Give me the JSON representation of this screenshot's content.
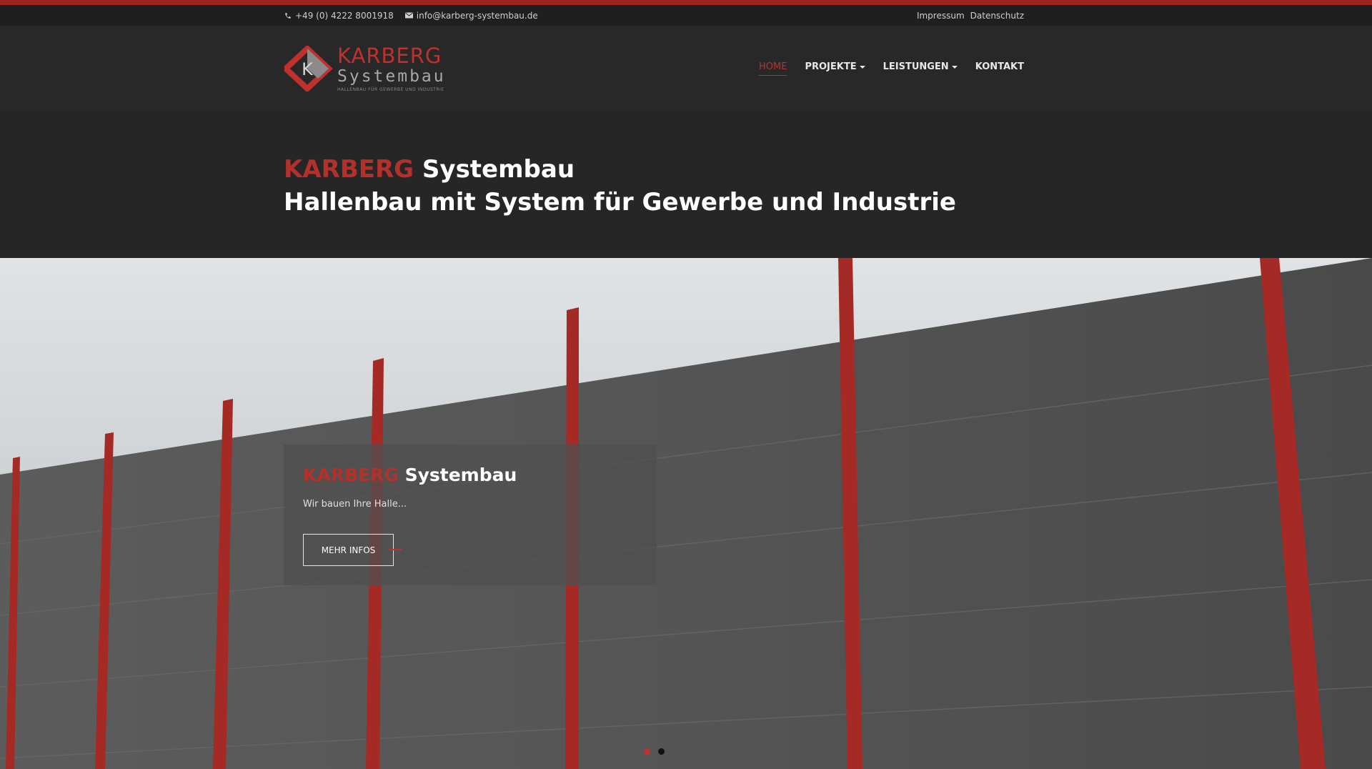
{
  "topbar": {
    "phone": "+49 (0) 4222 8001918",
    "email": "info@karberg-systembau.de",
    "links": [
      "Impressum",
      "Datenschutz"
    ]
  },
  "logo": {
    "brand": "KARBERG",
    "sub": "Systembau",
    "tagline": "HALLENBAU FÜR GEWERBE UND INDUSTRIE",
    "letter": "K"
  },
  "nav": {
    "items": [
      {
        "label": "HOME",
        "active": true
      },
      {
        "label": "PROJEKTE",
        "dropdown": true
      },
      {
        "label": "LEISTUNGEN",
        "dropdown": true
      },
      {
        "label": "KONTAKT"
      }
    ]
  },
  "intro": {
    "brand": "KARBERG",
    "title_rest": " Systembau",
    "subtitle": "Hallenbau mit System für Gewerbe und Industrie"
  },
  "slider": {
    "brand": "KARBERG",
    "title_rest": " Systembau",
    "text": "Wir bauen Ihre Halle...",
    "button": "MEHR INFOS",
    "slides_count": 2,
    "active_slide": 1
  },
  "colors": {
    "accent": "#b4302a",
    "background": "#262626",
    "topbar": "#1f1f1f"
  },
  "icons": {
    "phone": "phone-icon",
    "email": "envelope-icon",
    "dropdown": "caret-down-icon"
  }
}
